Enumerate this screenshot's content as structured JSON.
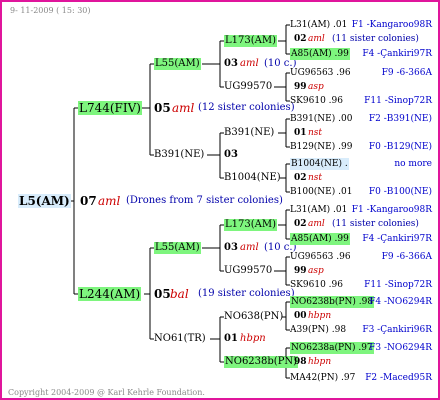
{
  "header": {
    "date_label": "9- 11-2009 ( 15: 30)"
  },
  "footer": {
    "copyright": "Copyright 2004-2009 @ Karl Kehrle Foundation."
  },
  "root": {
    "name": "L5(AM)",
    "gen": "07",
    "race": "aml",
    "note": "(Drones from 7 sister colonies)"
  },
  "g1_top": {
    "name": "L744(FIV)",
    "gen": "05",
    "race": "aml",
    "note": "(12 sister colonies)"
  },
  "g1_bot": {
    "name": "L244(AM)",
    "gen": "05",
    "race": "bal",
    "note": "(19 sister colonies)"
  },
  "g2_top_a": {
    "name": "L55(AM)"
  },
  "g2_top_b": {
    "name": "B391(NE)"
  },
  "g2_bot_a": {
    "name": "L55(AM)"
  },
  "g2_bot_b": {
    "name": "NO61(TR)"
  },
  "g3": {
    "a": {
      "name": "L173(AM)",
      "gen": "03",
      "race": "aml",
      "note": "(10 c.)"
    },
    "b": {
      "name": "UG99570"
    },
    "c": {
      "name": "B391(NE)",
      "gen": "03"
    },
    "d": {
      "name": "B1004(NE)"
    },
    "e": {
      "name": "L173(AM)",
      "gen": "03",
      "race": "aml",
      "note": "(10 c.)"
    },
    "f": {
      "name": "UG99570"
    },
    "g": {
      "name": "NO638(PN)",
      "gen": "01",
      "race": "hbpn"
    },
    "h": {
      "name": "NO6238b(PN)"
    }
  },
  "leaves": [
    {
      "text": "L31(AM) .01",
      "right": "F1 -Kangaroo98R"
    },
    {
      "gen": "02",
      "race": "aml",
      "note": "(11 sister colonies)"
    },
    {
      "text": "A85(AM) .99",
      "right": "F4 -Çankiri97R",
      "hl": true
    },
    {
      "text": "UG96563 .96",
      "right": "F9 -6-366A"
    },
    {
      "gen": "99",
      "race": "asp"
    },
    {
      "text": "SK9610 .96",
      "right": "F11 -Sinop72R"
    },
    {
      "text": "B391(NE) .00",
      "right": "F2 -B391(NE)"
    },
    {
      "gen": "01",
      "race": "nst"
    },
    {
      "text": "B129(NE) .99",
      "right": "F0 -B129(NE)"
    },
    {
      "text": "B1004(NE) .",
      "right": "no more",
      "hlb": true
    },
    {
      "gen": "02",
      "race": "nst"
    },
    {
      "text": "B100(NE) .01",
      "right": "F0 -B100(NE)"
    },
    {
      "text": "L31(AM) .01",
      "right": "F1 -Kangaroo98R"
    },
    {
      "gen": "02",
      "race": "aml",
      "note": "(11 sister colonies)"
    },
    {
      "text": "A85(AM) .99",
      "right": "F4 -Çankiri97R",
      "hl": true
    },
    {
      "text": "UG96563 .96",
      "right": "F9 -6-366A"
    },
    {
      "gen": "99",
      "race": "asp"
    },
    {
      "text": "SK9610 .96",
      "right": "F11 -Sinop72R"
    },
    {
      "text": "NO6238b(PN) .98",
      "right": "F4 -NO6294R",
      "hl": true
    },
    {
      "gen": "00",
      "race": "hbpn"
    },
    {
      "text": "A39(PN) .98",
      "right": "F3 -Çankiri96R"
    },
    {
      "text": "NO6238a(PN) .97",
      "right": "F3 -NO6294R",
      "hl": true
    },
    {
      "gen": "98",
      "race": "hbpn"
    },
    {
      "text": "MA42(PN) .97",
      "right": "F2 -Maced95R"
    }
  ]
}
